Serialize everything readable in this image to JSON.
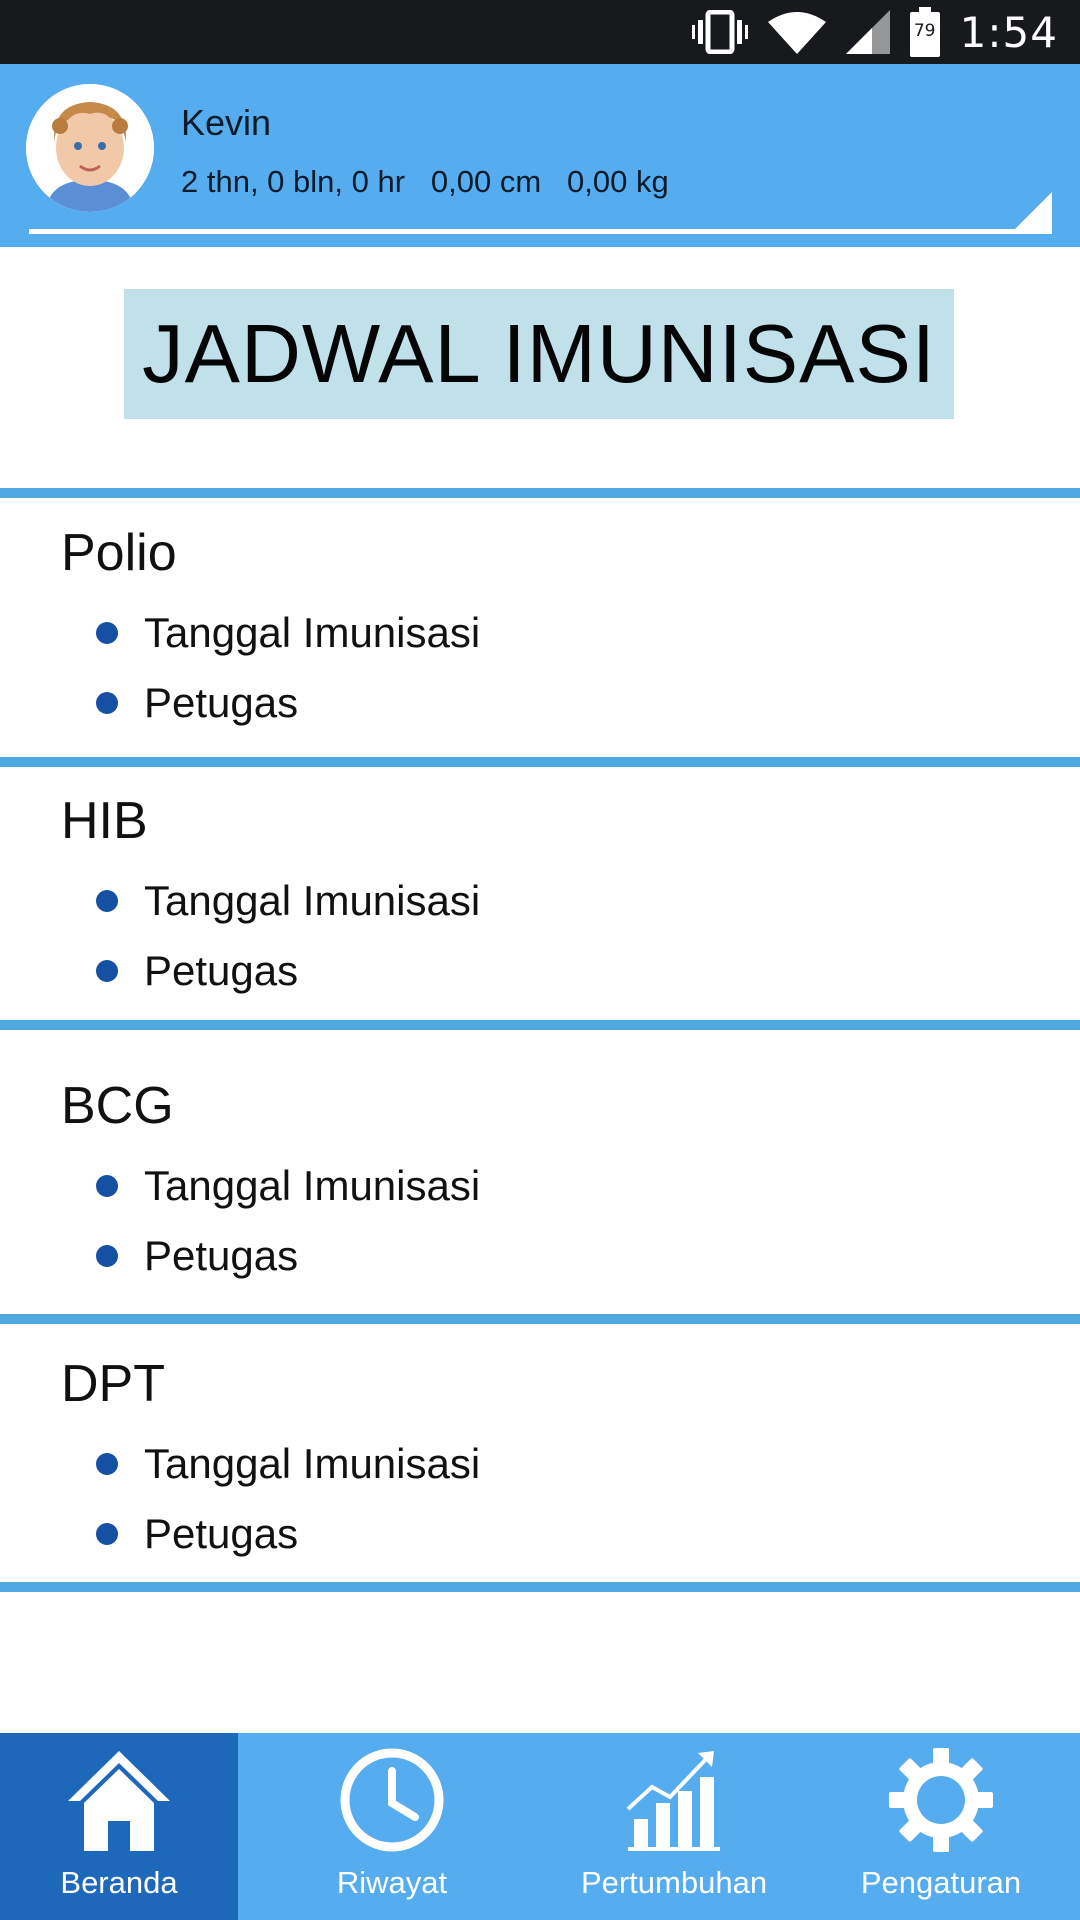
{
  "status_bar": {
    "battery_level": "79",
    "time": "1:54",
    "icons": [
      "vibrate-icon",
      "wifi-icon",
      "cellular-signal-icon",
      "battery-icon"
    ]
  },
  "profile": {
    "name": "Kevin",
    "age": "2 thn, 0 bln, 0 hr",
    "height": "0,00 cm",
    "weight": "0,00 kg",
    "avatar_icon": "child-avatar"
  },
  "page": {
    "title": "JADWAL IMUNISASI"
  },
  "vaccines": [
    {
      "name": "Polio",
      "details": [
        "Tanggal Imunisasi",
        "Petugas"
      ]
    },
    {
      "name": "HIB",
      "details": [
        "Tanggal Imunisasi",
        "Petugas"
      ]
    },
    {
      "name": "BCG",
      "details": [
        "Tanggal Imunisasi",
        "Petugas"
      ]
    },
    {
      "name": "DPT",
      "details": [
        "Tanggal Imunisasi",
        "Petugas"
      ]
    }
  ],
  "bottom_nav": {
    "items": [
      {
        "label": "Beranda",
        "icon": "home-icon",
        "active": true
      },
      {
        "label": "Riwayat",
        "icon": "clock-icon",
        "active": false
      },
      {
        "label": "Pertumbuhan",
        "icon": "growth-chart-icon",
        "active": false
      },
      {
        "label": "Pengaturan",
        "icon": "gear-icon",
        "active": false
      }
    ]
  },
  "colors": {
    "header_blue": "#55acee",
    "active_nav_blue": "#1e68bb",
    "divider_blue": "#4fa8e0",
    "title_bg": "#c0e0ea",
    "bullet_blue": "#1650a3",
    "status_bar": "#17191c"
  }
}
